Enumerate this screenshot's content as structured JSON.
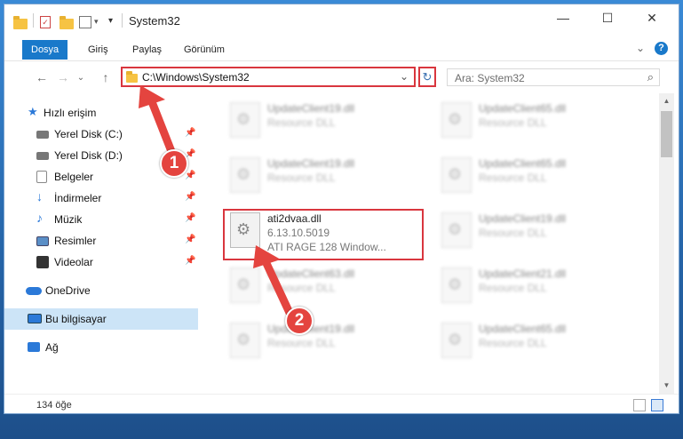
{
  "window": {
    "title": "System32",
    "minimize_glyph": "—",
    "maximize_glyph": "☐",
    "close_glyph": "✕"
  },
  "ribbon": {
    "tabs": [
      {
        "label": "Dosya",
        "active": true
      },
      {
        "label": "Giriş",
        "active": false
      },
      {
        "label": "Paylaş",
        "active": false
      },
      {
        "label": "Görünüm",
        "active": false
      }
    ],
    "expand_glyph": "⌄",
    "help_glyph": "?"
  },
  "nav": {
    "back_glyph": "←",
    "forward_glyph": "→",
    "recent_glyph": "⌄",
    "up_glyph": "↑",
    "address": "C:\\Windows\\System32",
    "dropdown_glyph": "⌄",
    "refresh_glyph": "↻",
    "search_placeholder": "Ara: System32",
    "search_icon_glyph": "⌕"
  },
  "sidebar": {
    "items": [
      {
        "label": "Hızlı erişim",
        "icon": "star-icon",
        "color": "#2b79d8"
      },
      {
        "label": "Yerel Disk (C:)",
        "icon": "drive-icon",
        "color": "#555555",
        "pinned": true
      },
      {
        "label": "Yerel Disk (D:)",
        "icon": "drive-icon",
        "color": "#555555",
        "pinned": true
      },
      {
        "label": "Belgeler",
        "icon": "documents-icon",
        "color": "#7a7a7a",
        "pinned": true
      },
      {
        "label": "İndirmeler",
        "icon": "download-icon",
        "color": "#2b79d8",
        "pinned": true
      },
      {
        "label": "Müzik",
        "icon": "music-icon",
        "color": "#2b79d8",
        "pinned": true
      },
      {
        "label": "Resimler",
        "icon": "pictures-icon",
        "color": "#5a8fc7",
        "pinned": true
      },
      {
        "label": "Videolar",
        "icon": "videos-icon",
        "color": "#333333",
        "pinned": true
      },
      {
        "label": "OneDrive",
        "icon": "cloud-icon",
        "color": "#2b79d8"
      },
      {
        "label": "Bu bilgisayar",
        "icon": "computer-icon",
        "color": "#2b79d8",
        "selected": true
      },
      {
        "label": "Ağ",
        "icon": "network-icon",
        "color": "#2b79d8"
      }
    ],
    "pin_glyph": "📌"
  },
  "files": {
    "left": [
      {
        "name": "UpdateClient19.dll",
        "desc": "Resource DLL"
      },
      {
        "name": "UpdateClient19.dll",
        "desc": "Resource DLL"
      },
      {
        "name": "ati2dvaa.dll",
        "desc": "6.13.10.5019",
        "desc2": "ATI RAGE 128 Window..."
      },
      {
        "name": "UpdateClient63.dll",
        "desc": "Resource DLL"
      },
      {
        "name": "UpdateClient19.dll",
        "desc": "Resource DLL"
      }
    ],
    "right": [
      {
        "name": "UpdateClient65.dll",
        "desc": "Resource DLL"
      },
      {
        "name": "UpdateClient65.dll",
        "desc": "Resource DLL"
      },
      {
        "name": "UpdateClient19.dll",
        "desc": "Resource DLL"
      },
      {
        "name": "UpdateClient21.dll",
        "desc": "Resource DLL"
      },
      {
        "name": "UpdateClient65.dll",
        "desc": "Resource DLL"
      }
    ]
  },
  "status": {
    "item_count": "134 öğe"
  },
  "annotations": {
    "step1": "1",
    "step2": "2",
    "color": "#e4443f"
  }
}
